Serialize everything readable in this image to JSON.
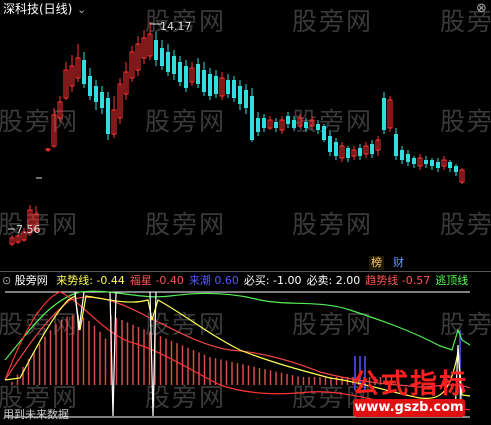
{
  "main_panel": {
    "title": "深科技(日线)",
    "high_label": "14.17",
    "low_label": "7.56",
    "close_icon": "close-icon",
    "collapse_icon": "chevron-down-icon",
    "markers": [
      "榜",
      "财"
    ]
  },
  "indicator_panel": {
    "name": "股旁网",
    "values": [
      {
        "label": "来势线:",
        "value": "-0.44",
        "color": "#ffff55"
      },
      {
        "label": "福星",
        "value": "-0.40",
        "color": "#ff5555"
      },
      {
        "label": "来潮",
        "value": "0.60",
        "color": "#5555ff"
      },
      {
        "label": "必买:",
        "value": "-1.00",
        "color": "#ffffff"
      },
      {
        "label": "必卖:",
        "value": "2.00",
        "color": "#ffffff"
      },
      {
        "label": "趋势线",
        "value": "-0.57",
        "color": "#ff5555"
      },
      {
        "label": "逃顶线",
        "value": "",
        "color": "#55ff55"
      }
    ],
    "bottom_note": "用到未来数据"
  },
  "watermarks": [
    "股旁网",
    "股旁网",
    "股旁网",
    "股旁网",
    "股旁网",
    "股旁网",
    "股旁网",
    "股旁网",
    "股旁网",
    "股旁网",
    "股旁网",
    "股旁网",
    "股旁网",
    "股旁网",
    "股旁网",
    "股旁网",
    "股旁网",
    "股旁网",
    "股旁网"
  ],
  "stamp": {
    "title": "公式指标",
    "url": "www.gszb.com"
  },
  "colors": {
    "up": "#ff3333",
    "down": "#33dddd",
    "background": "#000000"
  }
}
